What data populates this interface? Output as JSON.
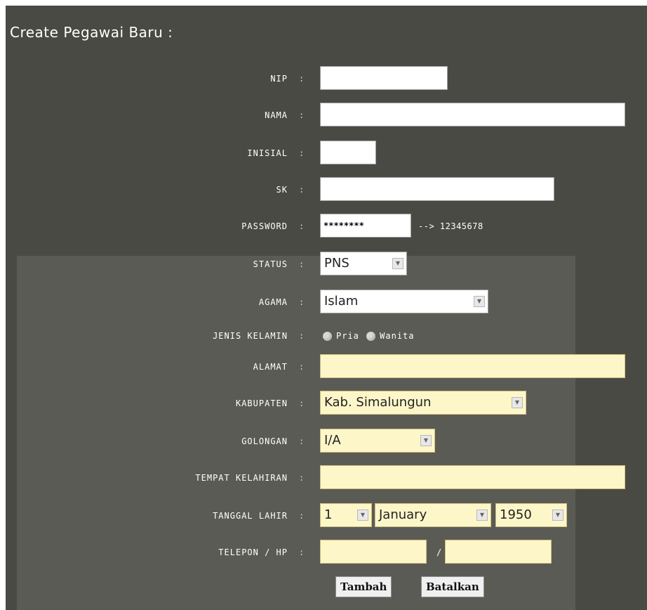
{
  "title": "Create Pegawai Baru :",
  "separator": ":",
  "fields": {
    "nip": {
      "label": "NIP",
      "value": ""
    },
    "nama": {
      "label": "NAMA",
      "value": ""
    },
    "inisial": {
      "label": "INISIAL",
      "value": ""
    },
    "sk": {
      "label": "SK",
      "value": ""
    },
    "password": {
      "label": "PASSWORD",
      "value": "********",
      "hint": "--> 12345678"
    },
    "status": {
      "label": "STATUS",
      "selected": "PNS"
    },
    "agama": {
      "label": "AGAMA",
      "selected": "Islam"
    },
    "jenis_kelamin": {
      "label": "JENIS KELAMIN",
      "options": [
        "Pria",
        "Wanita"
      ]
    },
    "alamat": {
      "label": "ALAMAT",
      "value": ""
    },
    "kabupaten": {
      "label": "KABUPATEN",
      "selected": "Kab. Simalungun"
    },
    "golongan": {
      "label": "GOLONGAN",
      "selected": "I/A"
    },
    "tempat_kelahiran": {
      "label": "TEMPAT KELAHIRAN",
      "value": ""
    },
    "tanggal_lahir": {
      "label": "TANGGAL LAHIR",
      "day": "1",
      "month": "January",
      "year": "1950"
    },
    "telepon": {
      "label": "TELEPON / HP",
      "separator": "/",
      "value1": "",
      "value2": ""
    }
  },
  "buttons": {
    "submit": "Tambah",
    "cancel": "Batalkan"
  },
  "colors": {
    "panel": "#4a4a45",
    "watermark_area": "#5b5b55",
    "input_cream": "#fdf6c8",
    "input_white": "#ffffff"
  }
}
